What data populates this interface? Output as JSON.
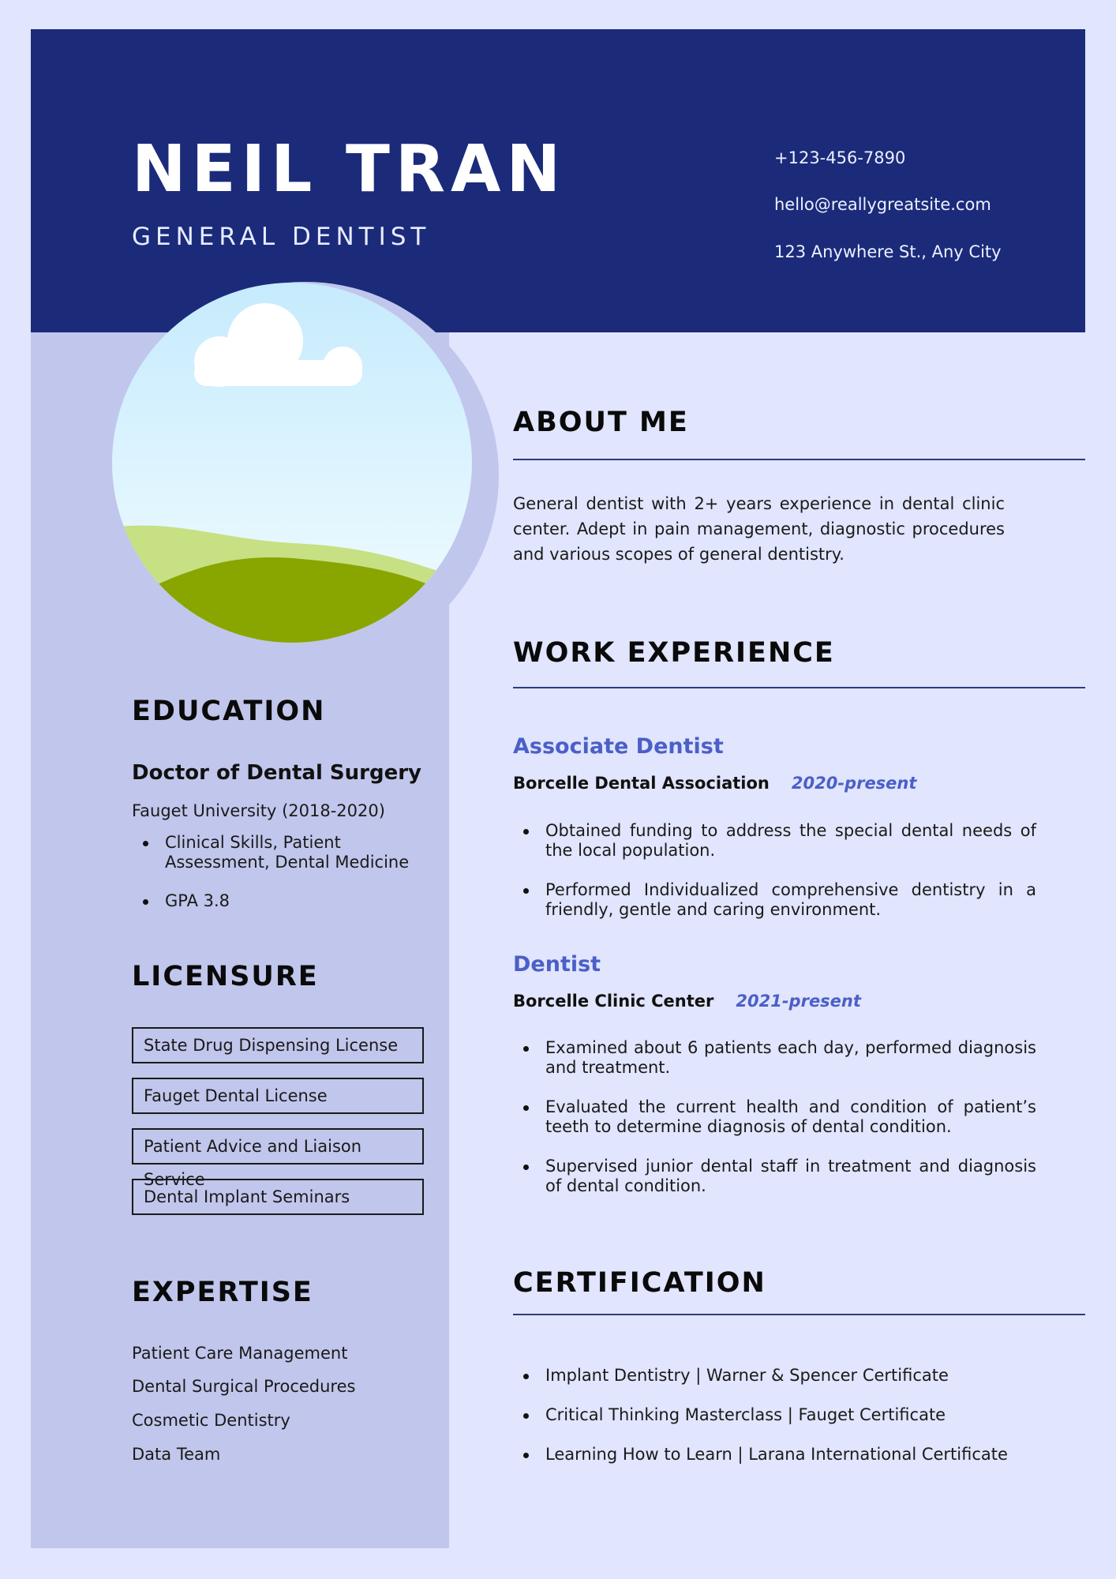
{
  "header": {
    "name": "NEIL TRAN",
    "role": "GENERAL DENTIST",
    "phone": "+123-456-7890",
    "email": "hello@reallygreatsite.com",
    "address": "123 Anywhere St., Any City"
  },
  "about": {
    "title": "ABOUT ME",
    "text": "General dentist with 2+ years experience in dental clinic center. Adept in pain management, diagnostic procedures and various scopes of general dentistry."
  },
  "education": {
    "title": "EDUCATION",
    "degree": "Doctor of Dental Surgery",
    "school": "Fauget University (2018-2020)",
    "points": [
      "Clinical Skills, Patient Assessment, Dental Medicine",
      "GPA 3.8"
    ]
  },
  "licensure": {
    "title": "LICENSURE",
    "items": [
      "State Drug Dispensing License",
      "Fauget Dental License",
      "Patient Advice and Liaison Service",
      "Dental Implant Seminars"
    ]
  },
  "expertise": {
    "title": "EXPERTISE",
    "items": [
      "Patient Care Management",
      "Dental Surgical Procedures",
      "Cosmetic Dentistry",
      "Data Team"
    ]
  },
  "work": {
    "title": "WORK EXPERIENCE",
    "jobs": [
      {
        "title": "Associate Dentist",
        "company": "Borcelle Dental Association",
        "period": "2020-present",
        "points": [
          "Obtained funding to address the special dental needs of the local population.",
          "Performed Individualized comprehensive dentistry in a friendly, gentle and caring environment."
        ]
      },
      {
        "title": "Dentist",
        "company": "Borcelle Clinic Center",
        "period": "2021-present",
        "points": [
          "Examined about 6 patients each day, performed diagnosis and treatment.",
          "Evaluated the current health and condition of patient’s teeth to determine diagnosis of dental condition.",
          "Supervised junior dental staff in treatment and diagnosis of dental condition."
        ]
      }
    ]
  },
  "certification": {
    "title": "CERTIFICATION",
    "items": [
      "Implant Dentistry | Warner & Spencer Certificate",
      "Critical Thinking Masterclass | Fauget Certificate",
      "Learning How to Learn | Larana International Certificate"
    ]
  },
  "photo": {
    "icon": "landscape-placeholder-icon"
  }
}
